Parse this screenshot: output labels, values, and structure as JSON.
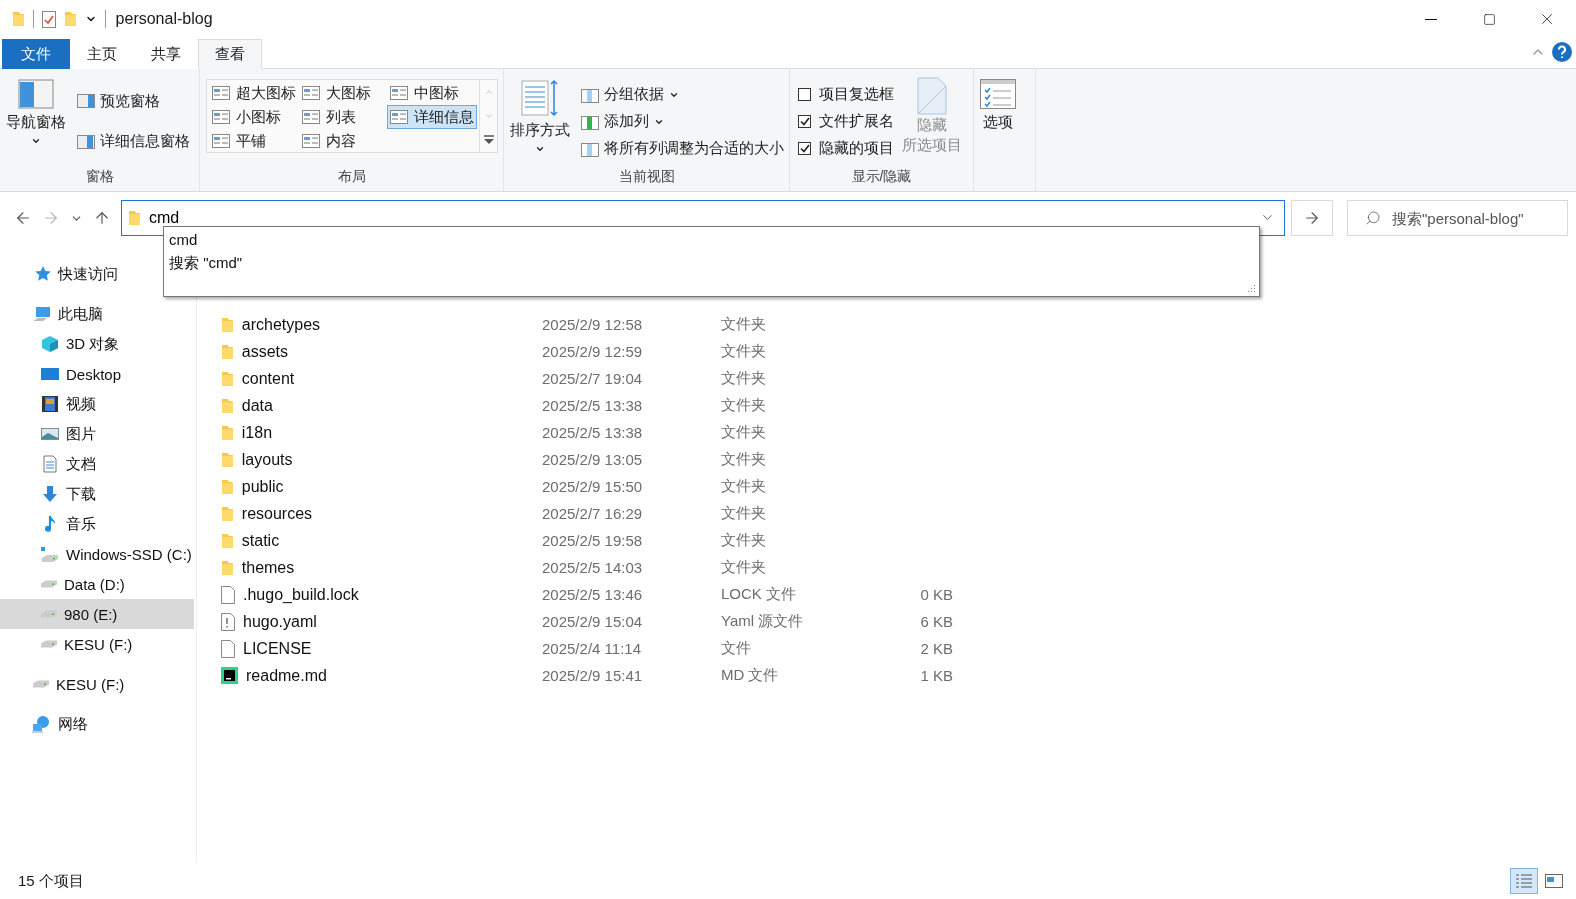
{
  "window": {
    "title": "personal-blog"
  },
  "ribbon_tabs": [
    {
      "label": "文件",
      "kind": "file",
      "selected": false
    },
    {
      "label": "主页",
      "kind": "tab",
      "selected": false
    },
    {
      "label": "共享",
      "kind": "tab",
      "selected": false
    },
    {
      "label": "查看",
      "kind": "tab",
      "selected": true
    }
  ],
  "panes_group": {
    "nav_pane": "导航窗格",
    "items": [
      "预览窗格",
      "详细信息窗格"
    ],
    "label": "窗格"
  },
  "layout_group": {
    "options": [
      {
        "label": "超大图标",
        "selected": false
      },
      {
        "label": "大图标",
        "selected": false
      },
      {
        "label": "中图标",
        "selected": false
      },
      {
        "label": "小图标",
        "selected": false
      },
      {
        "label": "列表",
        "selected": false
      },
      {
        "label": "详细信息",
        "selected": true
      },
      {
        "label": "平铺",
        "selected": false
      },
      {
        "label": "内容",
        "selected": false
      }
    ],
    "label": "布局"
  },
  "view_group": {
    "sort": "排序方式",
    "items": [
      {
        "label": "分组依据",
        "dropdown": true
      },
      {
        "label": "添加列",
        "dropdown": true
      },
      {
        "label": "将所有列调整为合适的大小",
        "dropdown": false
      }
    ],
    "label": "当前视图"
  },
  "show_hide_group": {
    "checkboxes": [
      {
        "label": "项目复选框",
        "checked": false
      },
      {
        "label": "文件扩展名",
        "checked": true
      },
      {
        "label": "隐藏的项目",
        "checked": true
      }
    ],
    "hide_selected": {
      "lines": [
        "隐藏",
        "所选项目"
      ],
      "disabled": true
    },
    "label": "显示/隐藏"
  },
  "options_button": "选项",
  "address": {
    "value": "cmd"
  },
  "search": {
    "placeholder": "搜索\"personal-blog\""
  },
  "suggestions": [
    "cmd",
    "搜索 \"cmd\""
  ],
  "nav": [
    {
      "label": "快速访问",
      "kind": "star",
      "selected": false
    },
    {
      "label": "此电脑",
      "kind": "pc",
      "selected": false,
      "children": [
        {
          "label": "3D 对象",
          "kind": "cube",
          "selected": false
        },
        {
          "label": "Desktop",
          "kind": "desktop",
          "selected": false
        },
        {
          "label": "视频",
          "kind": "video",
          "selected": false
        },
        {
          "label": "图片",
          "kind": "picture",
          "selected": false
        },
        {
          "label": "文档",
          "kind": "document",
          "selected": false
        },
        {
          "label": "下载",
          "kind": "download",
          "selected": false
        },
        {
          "label": "音乐",
          "kind": "music",
          "selected": false
        },
        {
          "label": "Windows-SSD (C:)",
          "kind": "system-drive",
          "selected": false
        },
        {
          "label": "Data (D:)",
          "kind": "drive",
          "selected": false
        },
        {
          "label": "980 (E:)",
          "kind": "drive",
          "selected": true
        },
        {
          "label": "KESU (F:)",
          "kind": "drive",
          "selected": false
        }
      ]
    },
    {
      "label": "KESU (F:)",
      "kind": "drive",
      "selected": false
    },
    {
      "label": "网络",
      "kind": "network",
      "selected": false
    }
  ],
  "files": [
    {
      "name": "archetypes",
      "date": "2025/2/9 12:58",
      "type": "文件夹",
      "kind": "folder"
    },
    {
      "name": "assets",
      "date": "2025/2/9 12:59",
      "type": "文件夹",
      "kind": "folder"
    },
    {
      "name": "content",
      "date": "2025/2/7 19:04",
      "type": "文件夹",
      "kind": "folder"
    },
    {
      "name": "data",
      "date": "2025/2/5 13:38",
      "type": "文件夹",
      "kind": "folder"
    },
    {
      "name": "i18n",
      "date": "2025/2/5 13:38",
      "type": "文件夹",
      "kind": "folder"
    },
    {
      "name": "layouts",
      "date": "2025/2/9 13:05",
      "type": "文件夹",
      "kind": "folder"
    },
    {
      "name": "public",
      "date": "2025/2/9 15:50",
      "type": "文件夹",
      "kind": "folder"
    },
    {
      "name": "resources",
      "date": "2025/2/7 16:29",
      "type": "文件夹",
      "kind": "folder"
    },
    {
      "name": "static",
      "date": "2025/2/5 19:58",
      "type": "文件夹",
      "kind": "folder"
    },
    {
      "name": "themes",
      "date": "2025/2/5 14:03",
      "type": "文件夹",
      "kind": "folder"
    },
    {
      "name": ".hugo_build.lock",
      "date": "2025/2/5 13:46",
      "type": "LOCK 文件",
      "size": "0 KB",
      "kind": "file"
    },
    {
      "name": "hugo.yaml",
      "date": "2025/2/9 15:04",
      "type": "Yaml 源文件",
      "size": "6 KB",
      "kind": "config"
    },
    {
      "name": "LICENSE",
      "date": "2025/2/4 11:14",
      "type": "文件",
      "size": "2 KB",
      "kind": "file"
    },
    {
      "name": "readme.md",
      "date": "2025/2/9 15:41",
      "type": "MD 文件",
      "size": "1 KB",
      "kind": "app"
    }
  ],
  "status_bar": {
    "count": "15 个项目",
    "views": [
      {
        "kind": "details",
        "selected": true
      },
      {
        "kind": "tiles",
        "selected": false
      }
    ]
  }
}
